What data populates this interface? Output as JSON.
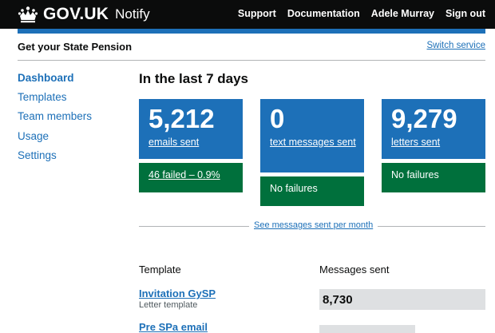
{
  "header": {
    "logo_text": "GOV.UK",
    "product": "Notify",
    "nav": [
      "Support",
      "Documentation",
      "Adele Murray",
      "Sign out"
    ]
  },
  "service": {
    "name": "Get your State Pension",
    "switch_link": "Switch service"
  },
  "sidebar": {
    "items": [
      {
        "label": "Dashboard",
        "active": true
      },
      {
        "label": "Templates"
      },
      {
        "label": "Team members"
      },
      {
        "label": "Usage"
      },
      {
        "label": "Settings"
      }
    ]
  },
  "main": {
    "heading": "In the last 7 days",
    "stats": [
      {
        "count": "5,212",
        "label": "emails sent",
        "status": "46 failed – 0.9%"
      },
      {
        "count": "0",
        "label": "text messages sent",
        "status": "No failures"
      },
      {
        "count": "9,279",
        "label": "letters sent",
        "status": "No failures"
      }
    ],
    "monthly_link": "See messages sent per month",
    "table": {
      "headers": [
        "Template",
        "Messages sent"
      ],
      "rows": [
        {
          "name": "Invitation GySP",
          "type": "Letter template",
          "count": "8,730"
        },
        {
          "name": "Pre SPa email",
          "type": "",
          "count": ""
        }
      ]
    }
  },
  "colors": {
    "header_bg": "#0b0c0c",
    "brand_blue": "#1d70b8",
    "success_green": "#00703c",
    "bar_grey": "#dee0e2"
  }
}
